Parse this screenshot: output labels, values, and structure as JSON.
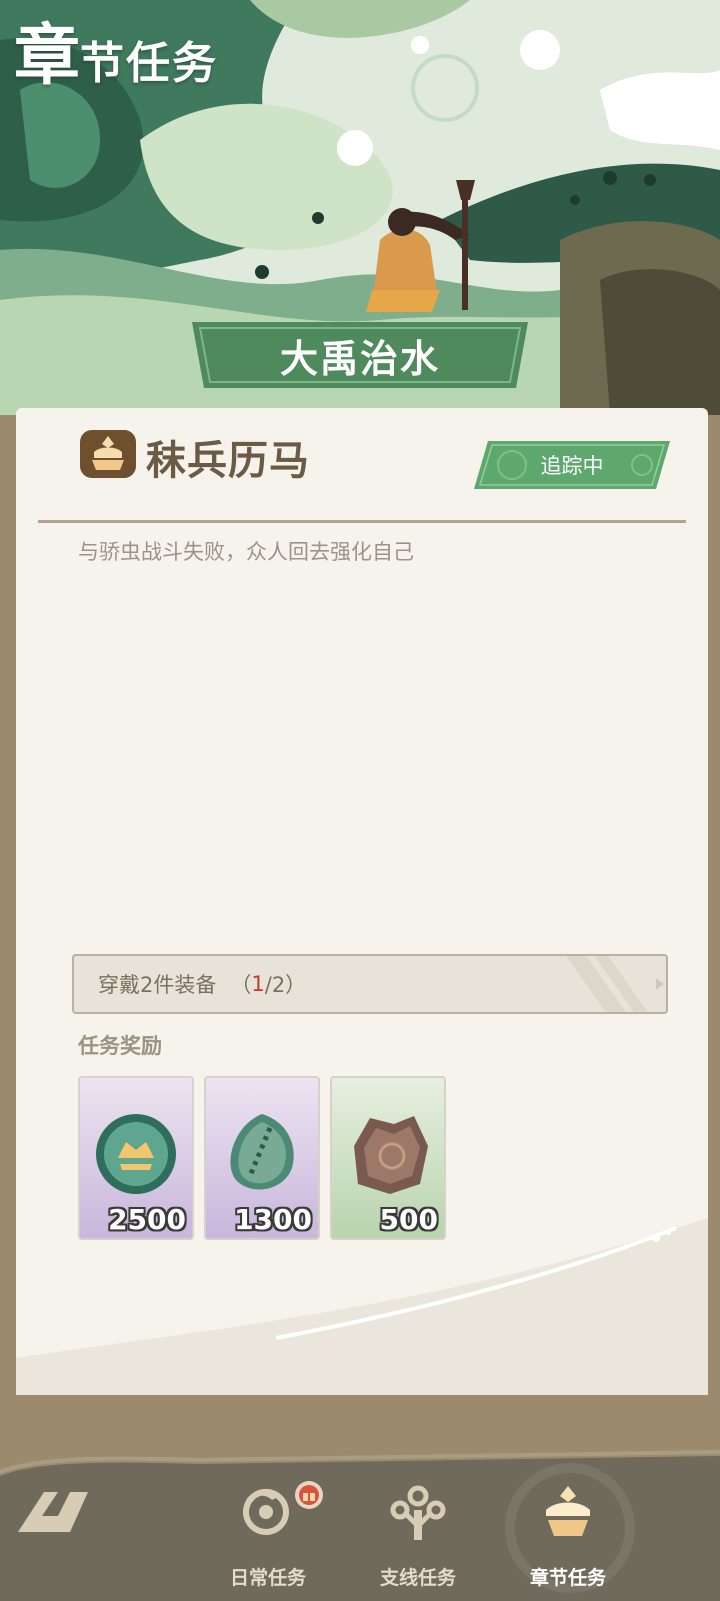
{
  "header": {
    "title_first": "章",
    "title_rest": "节任务",
    "chapter_name": "大禹治水"
  },
  "quest": {
    "title": "秣兵历马",
    "track_label": "追踪中",
    "description": "与骄虫战斗失败，众人回去强化自己",
    "objective": {
      "label": "穿戴2件装备",
      "open": "（",
      "current": "1",
      "sep_total": "/2）"
    }
  },
  "rewards": {
    "heading": "任务奖励",
    "items": [
      {
        "icon": "jade-coin-icon",
        "quantity": "2500",
        "rarity_color": "#c9b6dc"
      },
      {
        "icon": "jade-tablet-icon",
        "quantity": "1300",
        "rarity_color": "#c9b6dc"
      },
      {
        "icon": "rock-ore-icon",
        "quantity": "500",
        "rarity_color": "#b9d4ad"
      }
    ]
  },
  "nav": {
    "back_icon": "back-arrow-icon",
    "tabs": [
      {
        "label": "日常任务",
        "icon": "bird-icon",
        "active": false,
        "badge_icon": "gift-badge-icon"
      },
      {
        "label": "支线任务",
        "icon": "branch-icon",
        "active": false
      },
      {
        "label": "章节任务",
        "icon": "chest-icon",
        "active": true
      }
    ]
  },
  "colors": {
    "accent_green": "#4f8a5c",
    "card_bg": "#f6f3ec",
    "frame_brown": "#9c8a6c",
    "nav_bg": "#6f6a5c",
    "progress_current": "#c23a2b"
  }
}
